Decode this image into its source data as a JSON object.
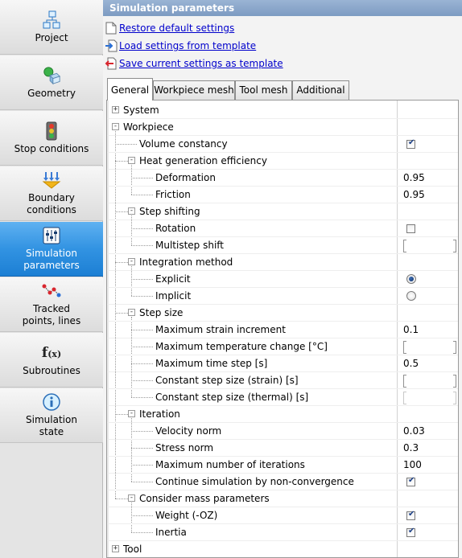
{
  "nav": {
    "items": [
      {
        "label": "Project",
        "icon": "project-icon"
      },
      {
        "label": "Geometry",
        "icon": "geometry-icon"
      },
      {
        "label": "Stop conditions",
        "icon": "traffic-light-icon"
      },
      {
        "label": "Boundary\nconditions",
        "icon": "boundary-arrows-icon"
      },
      {
        "label": "Simulation\nparameters",
        "icon": "sliders-icon",
        "active": true
      },
      {
        "label": "Tracked\npoints, lines",
        "icon": "tracked-points-icon"
      },
      {
        "label": "Subroutines",
        "icon": "function-icon"
      },
      {
        "label": "Simulation\nstate",
        "icon": "info-icon"
      }
    ]
  },
  "panel": {
    "title": "Simulation parameters",
    "actions": [
      {
        "label": "Restore default settings",
        "icon": "restore-icon"
      },
      {
        "label": "Load settings from template",
        "icon": "load-icon"
      },
      {
        "label": "Save current settings as template",
        "icon": "save-icon"
      }
    ],
    "tabs": [
      {
        "label": "General",
        "active": true
      },
      {
        "label": "Workpiece mesh"
      },
      {
        "label": "Tool mesh"
      },
      {
        "label": "Additional"
      }
    ]
  },
  "grid": {
    "rows": [
      {
        "label": "System",
        "expander": "+"
      },
      {
        "label": "Workpiece",
        "expander": "-"
      },
      {
        "label": "Volume constancy",
        "value_type": "checkbox",
        "checked": true
      },
      {
        "label": "Heat generation efficiency",
        "expander": "-"
      },
      {
        "label": "Deformation",
        "value": "0.95"
      },
      {
        "label": "Friction",
        "value": "0.95"
      },
      {
        "label": "Step shifting",
        "expander": "-"
      },
      {
        "label": "Rotation",
        "value_type": "checkbox",
        "checked": false
      },
      {
        "label": "Multistep shift",
        "value_type": "input"
      },
      {
        "label": "Integration method",
        "expander": "-"
      },
      {
        "label": "Explicit",
        "value_type": "radio",
        "checked": true
      },
      {
        "label": "Implicit",
        "value_type": "radio",
        "checked": false
      },
      {
        "label": "Step size",
        "expander": "-"
      },
      {
        "label": "Maximum strain increment",
        "value": "0.1"
      },
      {
        "label": "Maximum temperature change [°C]",
        "value_type": "input"
      },
      {
        "label": "Maximum time step [s]",
        "value": "0.5"
      },
      {
        "label": "Constant step size (strain) [s]",
        "value_type": "input"
      },
      {
        "label": "Constant step size (thermal) [s]",
        "value_type": "input",
        "disabled": true
      },
      {
        "label": "Iteration",
        "expander": "-"
      },
      {
        "label": "Velocity norm",
        "value": "0.03"
      },
      {
        "label": "Stress norm",
        "value": "0.3"
      },
      {
        "label": "Maximum number of iterations",
        "value": "100"
      },
      {
        "label": "Continue simulation by non-convergence",
        "value_type": "checkbox",
        "checked": true
      },
      {
        "label": "Consider mass parameters",
        "expander": "-"
      },
      {
        "label": "Weight (-OZ)",
        "value_type": "checkbox",
        "checked": true
      },
      {
        "label": "Inertia",
        "value_type": "checkbox",
        "checked": true
      },
      {
        "label": "Tool",
        "expander": "+"
      }
    ]
  }
}
